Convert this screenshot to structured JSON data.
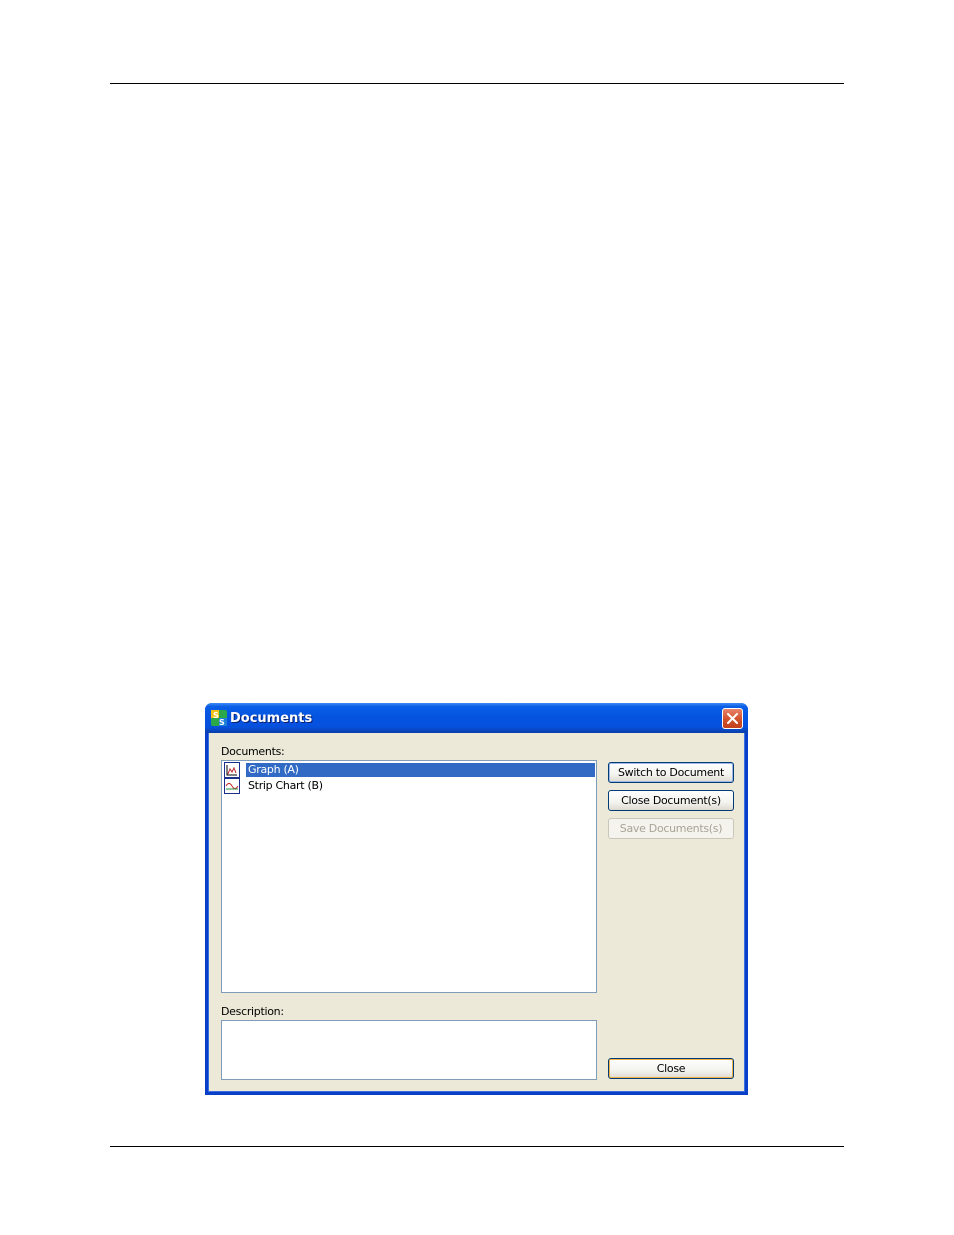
{
  "dialog": {
    "title": "Documents",
    "documents_label": "Documents:",
    "description_label": "Description:",
    "description_value": "",
    "documents": [
      {
        "label": "Graph (A)",
        "icon": "graph-doc-icon",
        "selected": true
      },
      {
        "label": "Strip Chart (B)",
        "icon": "strip-chart-doc-icon",
        "selected": false
      }
    ],
    "buttons": {
      "switch": "Switch to Document",
      "close_docs": "Close Document(s)",
      "save_docs": "Save Documents(s)",
      "close": "Close"
    }
  },
  "colors": {
    "titlebar": "#0554e1",
    "dialog_face": "#ece9d8",
    "selection": "#316ac5"
  }
}
